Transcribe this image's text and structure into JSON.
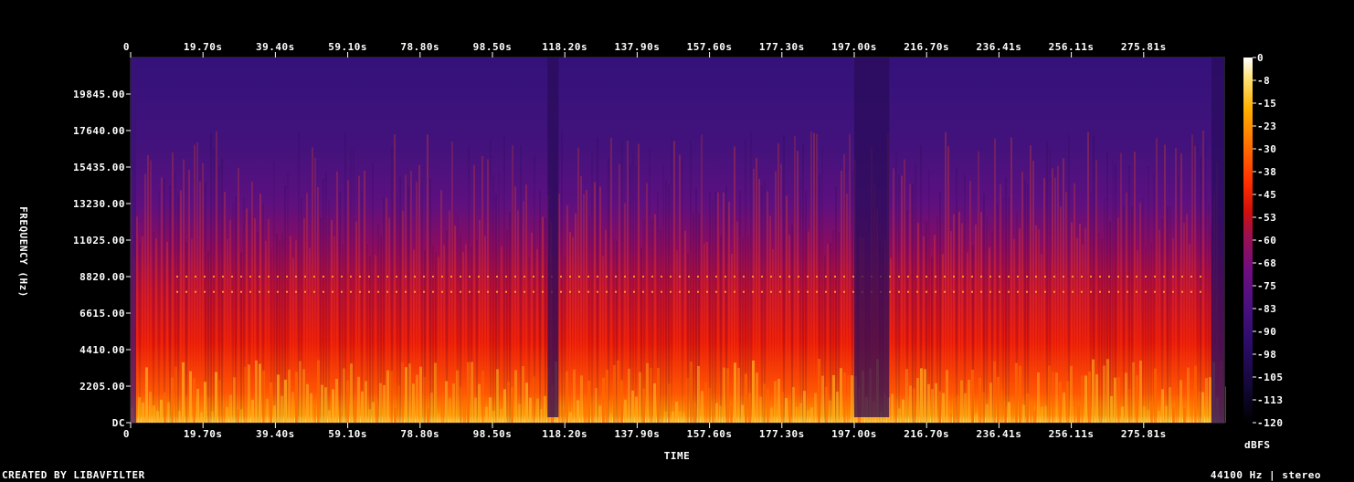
{
  "chart_data": {
    "type": "heatmap",
    "xlabel": "TIME",
    "ylabel": "FREQUENCY (Hz)",
    "colorbar_label": "dBFS",
    "x_ticks": [
      "0",
      "19.70s",
      "39.40s",
      "59.10s",
      "78.80s",
      "98.50s",
      "118.20s",
      "137.90s",
      "157.60s",
      "177.30s",
      "197.00s",
      "216.70s",
      "236.41s",
      "256.11s",
      "275.81s"
    ],
    "y_ticks": [
      "DC",
      "2205.00",
      "4410.00",
      "6615.00",
      "8820.00",
      "11025.00",
      "13230.00",
      "15435.00",
      "17640.00",
      "19845.00"
    ],
    "y_tick_values": [
      0,
      2205,
      4410,
      6615,
      8820,
      11025,
      13230,
      15435,
      17640,
      19845
    ],
    "ylim": [
      0,
      22050
    ],
    "xlim": [
      0,
      295.5
    ],
    "colorbar_ticks": [
      "0",
      "-8",
      "-15",
      "-23",
      "-30",
      "-38",
      "-45",
      "-53",
      "-60",
      "-68",
      "-75",
      "-83",
      "-90",
      "-98",
      "-105",
      "-113",
      "-120"
    ],
    "colorbar_range": [
      -120,
      0
    ],
    "colormap": [
      "#000000",
      "#1a0a4a",
      "#3a0f7a",
      "#5a128a",
      "#7a107a",
      "#a0104a",
      "#d0100a",
      "#ff3a00",
      "#ff7a00",
      "#ffb000",
      "#ffe060",
      "#ffffff"
    ],
    "quiet_segments_s": [
      [
        113.5,
        116.5
      ],
      [
        197.0,
        206.5
      ]
    ],
    "harmonic_lines_hz": [
      8820,
      7900
    ]
  },
  "footer": {
    "left": "CREATED BY LIBAVFILTER",
    "right": "44100 Hz | stereo"
  }
}
